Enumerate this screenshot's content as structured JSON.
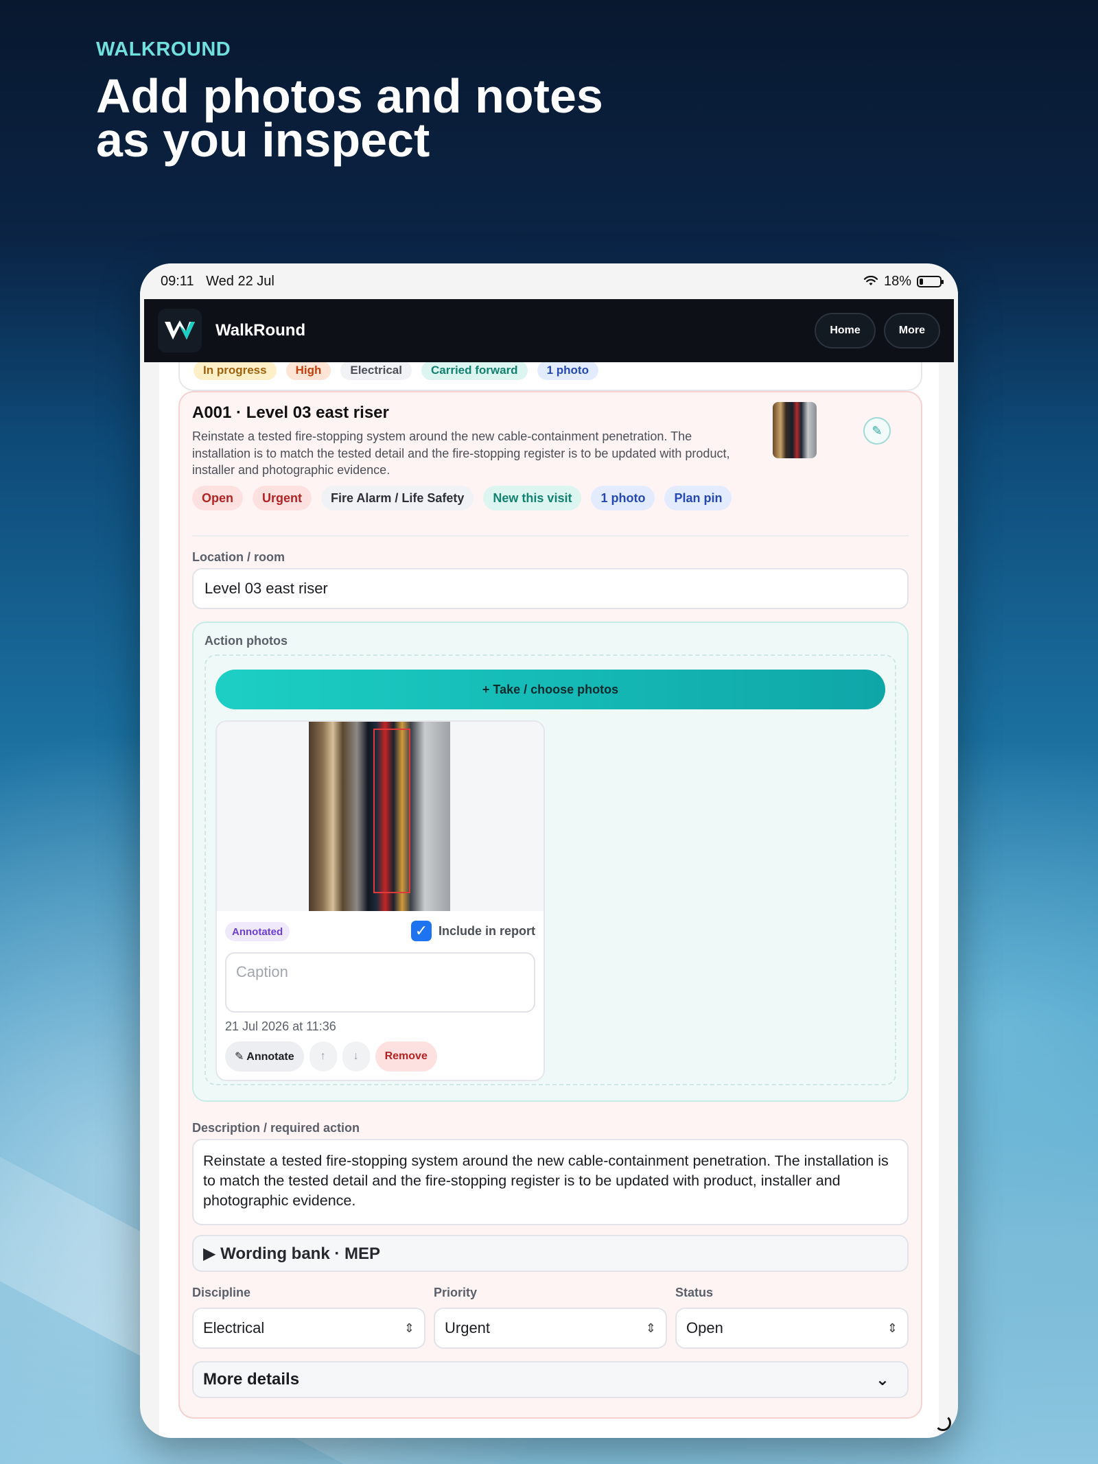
{
  "hero": {
    "eyebrow": "WALKROUND",
    "headline_line1": "Add photos and notes",
    "headline_line2": "as you inspect"
  },
  "status_bar": {
    "time": "09:11",
    "date": "Wed 22 Jul",
    "battery": "18%",
    "battery_level": 0.18
  },
  "app_bar": {
    "title": "WalkRound",
    "home_label": "Home",
    "more_label": "More"
  },
  "previous_card_tags": [
    {
      "label": "In progress",
      "bg": "#fdf0c8",
      "fg": "#a1620f"
    },
    {
      "label": "High",
      "bg": "#fde4d5",
      "fg": "#c2410c"
    },
    {
      "label": "Electrical",
      "bg": "#f1f2f5",
      "fg": "#4b4f57"
    },
    {
      "label": "Carried forward",
      "bg": "#dcf5f1",
      "fg": "#13816f"
    },
    {
      "label": "1 photo",
      "bg": "#e3ecfe",
      "fg": "#2548b5"
    }
  ],
  "action": {
    "title": "A001 · Level 03 east riser",
    "description": "Reinstate a tested fire-stopping system around the new cable-containment penetration. The installation is to match the tested detail and the fire-stopping register is to be updated with product, installer and photographic evidence.",
    "edit_icon": "pencil-icon",
    "chips": [
      {
        "label": "Open",
        "style": "red"
      },
      {
        "label": "Urgent",
        "style": "red"
      },
      {
        "label": "Fire Alarm / Life Safety",
        "style": "plain"
      },
      {
        "label": "New this visit",
        "style": "teal"
      },
      {
        "label": "1 photo",
        "style": "blue"
      },
      {
        "label": "Plan pin",
        "style": "blue"
      }
    ]
  },
  "location": {
    "label": "Location / room",
    "value": "Level 03 east riser"
  },
  "photos": {
    "label": "Action photos",
    "take_button": "+ Take / choose photos",
    "items": [
      {
        "badge": "Annotated",
        "include_label": "Include in report",
        "include_checked": true,
        "caption_placeholder": "Caption",
        "timestamp": "21 Jul 2026 at 11:36",
        "annotate_label": "✎ Annotate",
        "up_icon": "↑",
        "down_icon": "↓",
        "remove_label": "Remove"
      }
    ]
  },
  "description": {
    "label": "Description / required action",
    "value": "Reinstate a tested fire-stopping system around the new cable-containment penetration. The installation is to match the tested detail and the fire-stopping register is to be updated with product, installer and photographic evidence."
  },
  "wording_bank": {
    "label": "▶ Wording bank · MEP"
  },
  "fields": {
    "discipline_label": "Discipline",
    "discipline_value": "Electrical",
    "priority_label": "Priority",
    "priority_value": "Urgent",
    "status_label": "Status",
    "status_value": "Open"
  },
  "more_details": {
    "label": "More details",
    "chevron": "⌄"
  }
}
